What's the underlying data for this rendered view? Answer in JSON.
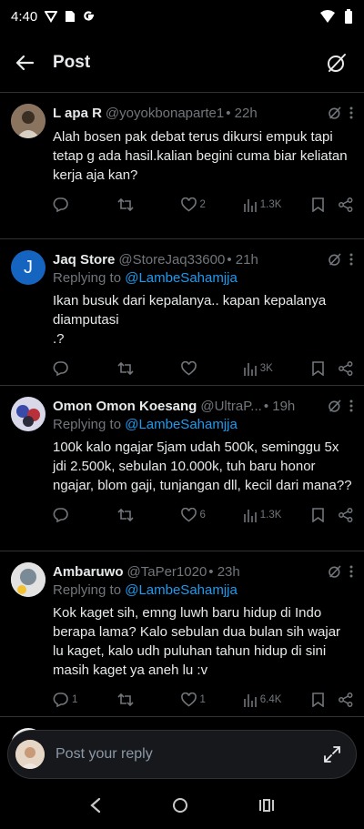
{
  "status_bar": {
    "time": "4:40"
  },
  "header": {
    "title": "Post",
    "back_icon": "arrow-left-icon",
    "grok_icon": "grok-icon"
  },
  "colors": {
    "background": "#000000",
    "accent": "#1d9bf0",
    "muted": "#71767b",
    "divider": "#2f3336"
  },
  "posts": [
    {
      "name": "L apa R",
      "handle": "@yoyokbonaparte1",
      "time": "• 22h",
      "replying_prefix": "",
      "replying_to": "",
      "text": "Alah bosen pak debat terus dikursi empuk tapi tetap g ada hasil.kalian begini cuma biar keliatan kerja aja kan?",
      "replies": "",
      "reposts": "",
      "likes": "2",
      "views": "1.3K"
    },
    {
      "name": "Jaq Store",
      "handle": "@StoreJaq33600",
      "time": "• 21h",
      "replying_prefix": "Replying to ",
      "replying_to": "@LambeSahamjja",
      "text": "Ikan busuk dari kepalanya.. kapan kepalanya diamputasi\n.?",
      "replies": "",
      "reposts": "",
      "likes": "",
      "views": "3K",
      "avatar_letter": "J"
    },
    {
      "name": "Omon Omon Koesang",
      "handle": "@UltraP...",
      "time": "• 19h",
      "replying_prefix": "Replying to ",
      "replying_to": "@LambeSahamjja",
      "text": "100k kalo ngajar 5jam udah 500k, seminggu 5x jdi 2.500k, sebulan 10.000k, tuh baru honor ngajar, blom gaji, tunjangan dll, kecil dari mana??",
      "replies": "",
      "reposts": "",
      "likes": "6",
      "views": "1.3K"
    },
    {
      "name": "Ambaruwo",
      "handle": "@TaPer1020",
      "time": "• 23h",
      "replying_prefix": "Replying to ",
      "replying_to": "@LambeSahamjja",
      "text": "Kok kaget sih, emng luwh baru hidup di Indo berapa lama? Kalo sebulan dua bulan sih wajar lu kaget, kalo udh puluhan tahun hidup di sini masih kaget ya aneh lu :v",
      "replies": "1",
      "reposts": "",
      "likes": "1",
      "views": "6.4K"
    }
  ],
  "reply_bar": {
    "placeholder": "Post your reply"
  }
}
